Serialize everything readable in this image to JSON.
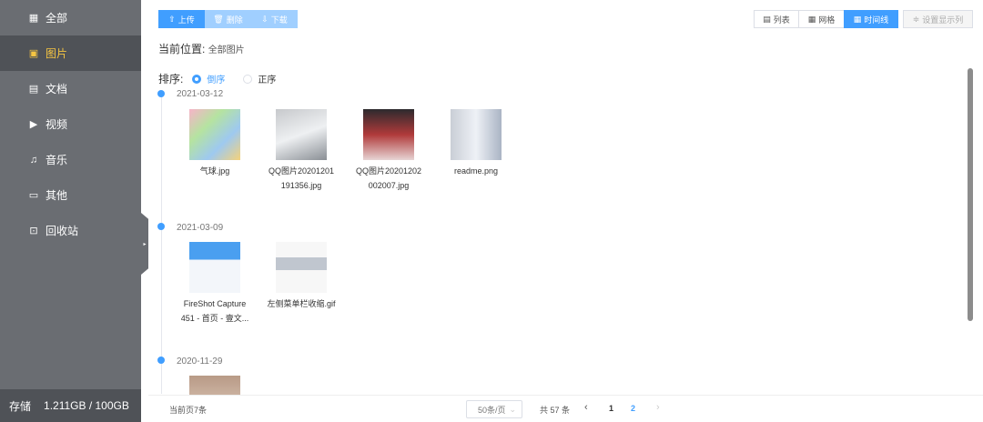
{
  "sidebar": {
    "items": [
      {
        "label": "全部",
        "icon": "grid-icon"
      },
      {
        "label": "图片",
        "icon": "image-icon"
      },
      {
        "label": "文档",
        "icon": "document-icon"
      },
      {
        "label": "视频",
        "icon": "video-icon"
      },
      {
        "label": "音乐",
        "icon": "headphones-icon"
      },
      {
        "label": "其他",
        "icon": "box-icon"
      },
      {
        "label": "回收站",
        "icon": "trash-icon"
      }
    ],
    "active": 1,
    "storage_label": "存储",
    "storage_value": "1.211GB / 100GB",
    "storage_used_fraction": 0.012
  },
  "toolbar": {
    "upload": "上传",
    "delete": "删除",
    "download": "下载"
  },
  "views": {
    "list": "列表",
    "grid": "网格",
    "timeline": "时间线",
    "columns": "设置显示列"
  },
  "breadcrumb": {
    "label": "当前位置:",
    "value": "全部图片"
  },
  "sort": {
    "label": "排序:",
    "desc": "倒序",
    "asc": "正序"
  },
  "groups": [
    {
      "date": "2021-03-12",
      "files": [
        {
          "name": "气球.jpg"
        },
        {
          "name": "QQ图片20201201191356.jpg",
          "line1": "QQ图片20201201",
          "line2": "191356.jpg"
        },
        {
          "name": "QQ图片20201202002007.jpg",
          "line1": "QQ图片20201202",
          "line2": "002007.jpg"
        },
        {
          "name": "readme.png"
        }
      ]
    },
    {
      "date": "2021-03-09",
      "files": [
        {
          "line1": "FireShot Capture",
          "line2": "451 - 首页 - 壹文..."
        },
        {
          "name": "左侧菜单栏收缩.gif"
        }
      ]
    },
    {
      "date": "2020-11-29"
    }
  ],
  "footer": {
    "current": "当前页7条",
    "page_size": "50条/页",
    "total": "共 57 条",
    "pages": [
      "1",
      "2"
    ],
    "active_page": "2"
  },
  "colors": {
    "accent": "#409eff",
    "sidebar": "#6a6d72",
    "active_text": "#f5c542"
  }
}
